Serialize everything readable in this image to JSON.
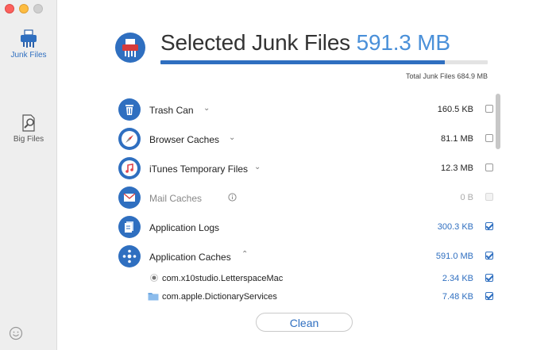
{
  "sidebar": {
    "items": [
      {
        "label": "Junk Files",
        "icon": "shredder-icon"
      },
      {
        "label": "Big Files",
        "icon": "magnifier-file-icon"
      }
    ]
  },
  "header": {
    "title": "Selected Junk Files",
    "size": "591.3 MB",
    "progress_fraction": 0.87,
    "total": "Total Junk Files 684.9 MB"
  },
  "categories": [
    {
      "name": "Trash Can",
      "size": "160.5 KB",
      "checked": false,
      "icon": "trash-icon"
    },
    {
      "name": "Browser Caches",
      "size": "81.1 MB",
      "checked": false,
      "icon": "compass-icon"
    },
    {
      "name": "iTunes Temporary Files",
      "size": "12.3 MB",
      "checked": false,
      "icon": "music-note-icon"
    },
    {
      "name": "Mail Caches",
      "size": "0 B",
      "checked": false,
      "icon": "mail-icon"
    },
    {
      "name": "Application Logs",
      "size": "300.3 KB",
      "checked": true,
      "icon": "log-icon"
    },
    {
      "name": "Application Caches",
      "size": "591.0 MB",
      "checked": true,
      "icon": "app-cache-icon"
    }
  ],
  "subitems": [
    {
      "name": "com.x10studio.LetterspaceMac",
      "size": "2.34 KB",
      "checked": true
    },
    {
      "name": "com.apple.DictionaryServices",
      "size": "7.48 KB",
      "checked": true
    }
  ],
  "actions": {
    "clean_label": "Clean"
  },
  "colors": {
    "accent": "#2f6fc0",
    "size_text": "#4a90d9"
  }
}
